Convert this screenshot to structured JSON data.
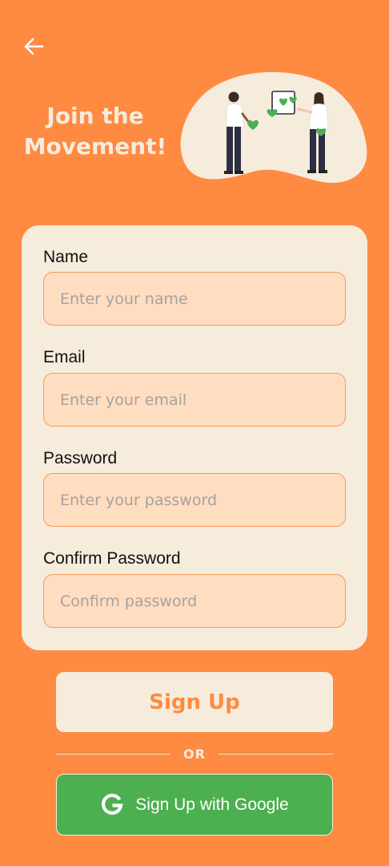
{
  "header": {
    "back_icon": "arrow-left-icon",
    "title_line1": "Join the",
    "title_line2": "Movement!"
  },
  "form": {
    "fields": [
      {
        "label": "Name",
        "placeholder": "Enter your name",
        "value": ""
      },
      {
        "label": "Email",
        "placeholder": "Enter your email",
        "value": ""
      },
      {
        "label": "Password",
        "placeholder": "Enter your password",
        "value": ""
      },
      {
        "label": "Confirm Password",
        "placeholder": "Confirm password",
        "value": ""
      }
    ]
  },
  "actions": {
    "signup_label": "Sign Up",
    "divider_text": "OR",
    "google_label": "Sign Up with Google",
    "google_icon": "google-g-icon"
  },
  "colors": {
    "background": "#FF8A42",
    "card": "#F6ECDC",
    "input_fill": "#FFDDC1",
    "input_border": "#F39A57",
    "google_green": "#4CAF50",
    "accent_green": "#4CAF50"
  }
}
